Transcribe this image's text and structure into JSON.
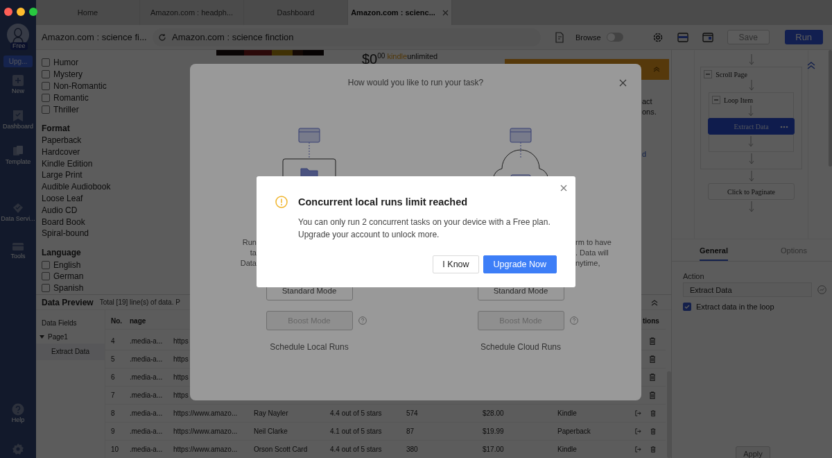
{
  "sidebar": {
    "plan_badge": "Free",
    "upgrade_button": "Upg...",
    "items": [
      {
        "label": "New",
        "kind": "new"
      },
      {
        "label": "Dashboard",
        "kind": "dashboard"
      },
      {
        "label": "Template",
        "kind": "template"
      },
      {
        "label": "Data Servi...",
        "kind": "service"
      },
      {
        "label": "Tools",
        "kind": "tools"
      }
    ],
    "footer_items": [
      {
        "label": "Help",
        "kind": "help"
      }
    ]
  },
  "tabs": [
    {
      "label": "Home",
      "selected": false
    },
    {
      "label": "Amazon.com : headph...",
      "selected": false
    },
    {
      "label": "Dashboard",
      "selected": false
    },
    {
      "label": "Amazon.com : scienc...",
      "selected": true
    }
  ],
  "toolbar": {
    "page_title": "Amazon.com : science fi...",
    "address": "Amazon.com : science finction",
    "browse_label": "Browse",
    "browse_on": false,
    "save_button": {
      "label": "Save",
      "disabled": true
    },
    "run_button": "Run"
  },
  "web_page": {
    "price": "$0$^{00}$",
    "badge": [
      "kindle",
      "unlimited"
    ],
    "filter_sections": [
      {
        "kind": "checkboxes",
        "options": [
          {
            "label": "Humor",
            "checked": false
          },
          {
            "label": "Mystery",
            "checked": false
          },
          {
            "label": "Non-Romantic",
            "checked": false
          },
          {
            "label": "Romantic",
            "checked": false
          },
          {
            "label": "Thriller",
            "checked": false
          }
        ]
      },
      {
        "kind": "links",
        "title": "Format",
        "options": [
          {
            "label": "Paperback"
          },
          {
            "label": "Hardcover"
          },
          {
            "label": "Kindle Edition"
          },
          {
            "label": "Large Print"
          },
          {
            "label": "Audible Audiobook"
          },
          {
            "label": "Loose Leaf"
          },
          {
            "label": "Audio CD"
          },
          {
            "label": "Board Book"
          },
          {
            "label": "Spiral-bound"
          }
        ]
      },
      {
        "kind": "checkboxes",
        "title": "Language",
        "options": [
          {
            "label": "English",
            "checked": false
          },
          {
            "label": "German",
            "checked": false
          },
          {
            "label": "Spanish",
            "checked": false
          }
        ]
      }
    ],
    "fragments": [
      {
        "text": "act",
        "kind": "text"
      },
      {
        "text": "ons.",
        "kind": "text"
      },
      {
        "text": "d",
        "kind": "link"
      }
    ]
  },
  "workflow": [
    {
      "label": "Scroll Page",
      "kind": "loop",
      "expanded": true,
      "children": [
        {
          "label": "Loop Item",
          "kind": "loop",
          "expanded": true,
          "children": [
            {
              "label": "Extract Data",
              "kind": "action",
              "selected": true
            }
          ]
        }
      ]
    },
    {
      "label": "Click to Paginate",
      "kind": "action",
      "selected": false
    }
  ],
  "properties": {
    "tabs": [
      {
        "label": "General",
        "selected": true
      },
      {
        "label": "Options",
        "selected": false
      }
    ],
    "action_label": "Action",
    "action_value": "Extract Data",
    "loop_checkbox": {
      "label": "Extract data in the loop",
      "checked": true
    },
    "apply_button": "Apply"
  },
  "data_preview": {
    "title": "Data Preview",
    "summary": "Total [19] line(s) of data. P",
    "fields_title": "Data Fields",
    "tree": [
      {
        "label": "Page1",
        "expanded": true,
        "children": [
          {
            "label": "Extract Data",
            "selected": true
          }
        ]
      }
    ],
    "table": {
      "columns": [
        "No.",
        "nage"
      ],
      "actions_header": "tions",
      "rows": [
        {
          "cells": [
            "4",
            ".media-a...",
            "https"
          ]
        },
        {
          "cells": [
            "5",
            ".media-a...",
            "https"
          ]
        },
        {
          "cells": [
            "6",
            ".media-a...",
            "https"
          ]
        },
        {
          "cells": [
            "7",
            ".media-a...",
            "https"
          ]
        },
        {
          "cells": [
            "8",
            ".media-a...",
            "https://www.amazo...",
            "Ray Nayler",
            "4.4 out of 5 stars",
            "574",
            "$28.00",
            "Kindle"
          ]
        },
        {
          "cells": [
            "9",
            ".media-a...",
            "https://www.amazo...",
            "Neil Clarke",
            "4.1 out of 5 stars",
            "87",
            "$19.99",
            "Paperback"
          ]
        },
        {
          "cells": [
            "10",
            ".media-a...",
            "https://www.amazo...",
            "Orson Scott Card",
            "4.4 out of 5 stars",
            "380",
            "$17.00",
            "Kindle"
          ]
        }
      ]
    }
  },
  "run_modal": {
    "title": "How would you like to run your task?",
    "options": [
      {
        "kind": "local",
        "description": [
          "Run",
          "ta",
          "Data"
        ],
        "standard_button": "Standard Mode",
        "boost_button": {
          "label": "Boost Mode",
          "disabled": true
        },
        "schedule_link": "Schedule Local Runs"
      },
      {
        "kind": "cloud",
        "description": [
          "rm to have",
          ". Data will",
          "nytime,"
        ],
        "standard_button": "Standard Mode",
        "boost_button": {
          "label": "Boost Mode",
          "disabled": true
        },
        "schedule_link": "Schedule Cloud Runs"
      }
    ]
  },
  "limit_dialog": {
    "title": "Concurrent local runs limit reached",
    "message": [
      "You can only run 2 concurrent tasks on your device with a Free plan.",
      "Upgrade your account to unlock more."
    ],
    "buttons": [
      {
        "label": "I Know",
        "kind": "secondary"
      },
      {
        "label": "Upgrade Now",
        "kind": "primary"
      }
    ]
  }
}
